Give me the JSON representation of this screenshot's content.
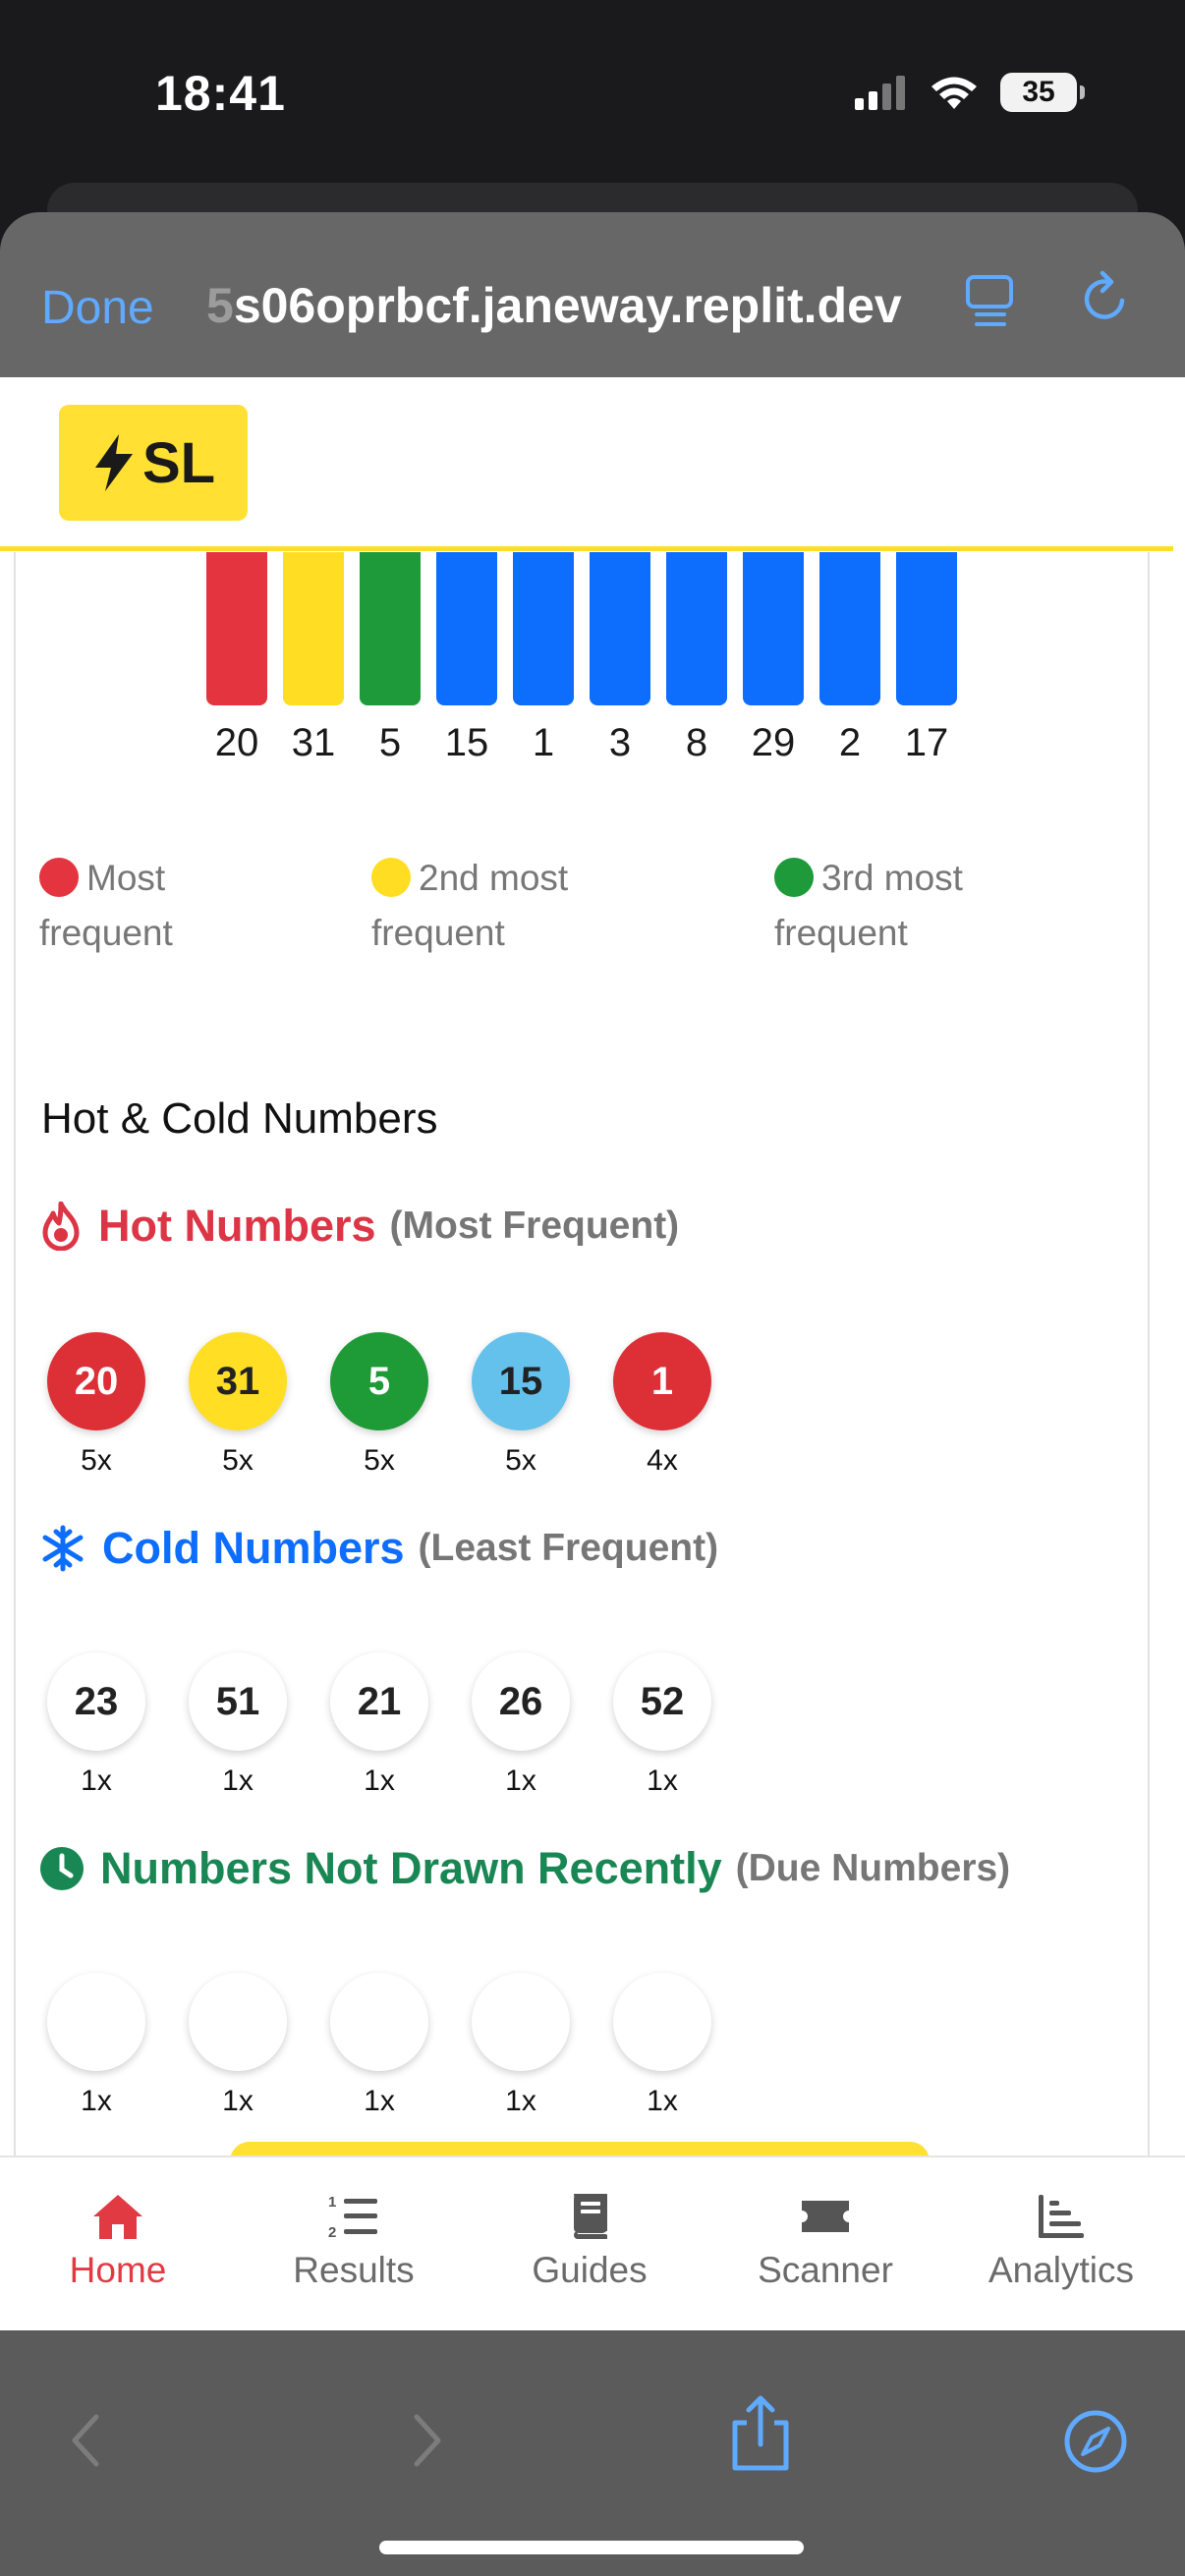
{
  "status_bar": {
    "time": "18:41",
    "battery": "35"
  },
  "browser": {
    "done_label": "Done",
    "url": "s06oprbcf.janeway.replit.dev",
    "url_fragment": "5"
  },
  "app": {
    "logo_text": "SL"
  },
  "frequency_chart": {
    "numbers": [
      "20",
      "31",
      "5",
      "15",
      "1",
      "3",
      "8",
      "29",
      "2",
      "17"
    ],
    "bar_colors": [
      "#e3343f",
      "#ffdd22",
      "#1e9a3a",
      "#0d6efd",
      "#0d6efd",
      "#0d6efd",
      "#0d6efd",
      "#0d6efd",
      "#0d6efd",
      "#0d6efd"
    ],
    "legend": [
      {
        "line1": "Most",
        "line2": "frequent",
        "color": "#e3343f"
      },
      {
        "line1": "2nd most",
        "line2": "frequent",
        "color": "#ffdd22"
      },
      {
        "line1": "3rd most",
        "line2": "frequent",
        "color": "#1e9a3a"
      }
    ]
  },
  "hot_cold": {
    "title": "Hot & Cold Numbers",
    "hot": {
      "label": "Hot Numbers",
      "sub": "(Most Frequent)",
      "color": "#dc3545",
      "balls": [
        {
          "n": "20",
          "count": "5x",
          "bg": "#dc2f36",
          "fg": "#ffffff"
        },
        {
          "n": "31",
          "count": "5x",
          "bg": "#ffde24",
          "fg": "#222222"
        },
        {
          "n": "5",
          "count": "5x",
          "bg": "#1e9a36",
          "fg": "#ffffff"
        },
        {
          "n": "15",
          "count": "5x",
          "bg": "#63c1ec",
          "fg": "#222222"
        },
        {
          "n": "1",
          "count": "4x",
          "bg": "#dc2f36",
          "fg": "#ffffff"
        }
      ]
    },
    "cold": {
      "label": "Cold Numbers",
      "sub": "(Least Frequent)",
      "color": "#0d6efd",
      "balls": [
        {
          "n": "23",
          "count": "1x"
        },
        {
          "n": "51",
          "count": "1x"
        },
        {
          "n": "21",
          "count": "1x"
        },
        {
          "n": "26",
          "count": "1x"
        },
        {
          "n": "52",
          "count": "1x"
        }
      ]
    },
    "due": {
      "label": "Numbers Not Drawn Recently",
      "sub": "(Due Numbers)",
      "color": "#198754",
      "balls": [
        {
          "n": "",
          "count": "1x"
        },
        {
          "n": "",
          "count": "1x"
        },
        {
          "n": "",
          "count": "1x"
        },
        {
          "n": "",
          "count": "1x"
        },
        {
          "n": "",
          "count": "1x"
        }
      ]
    }
  },
  "tabs": [
    {
      "label": "Home",
      "icon": "home-icon",
      "active": true
    },
    {
      "label": "Results",
      "icon": "list-ordered-icon"
    },
    {
      "label": "Guides",
      "icon": "book-icon"
    },
    {
      "label": "Scanner",
      "icon": "ticket-icon"
    },
    {
      "label": "Analytics",
      "icon": "chart-icon"
    }
  ],
  "colors": {
    "accent_red": "#e23a43",
    "ios_blue": "#5fa9ff",
    "brand_yellow": "#ffe033"
  }
}
